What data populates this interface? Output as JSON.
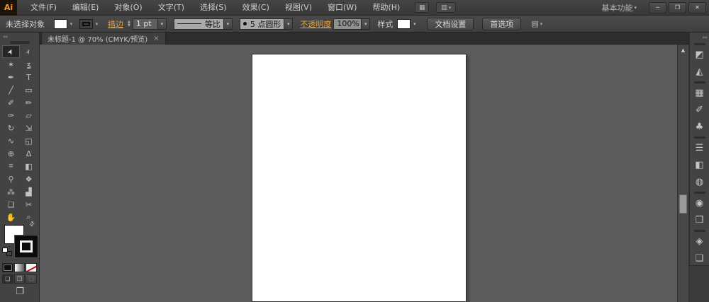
{
  "window": {
    "logo": "Ai",
    "workspace_label": "基本功能",
    "controls": {
      "minimize": "─",
      "restore": "❐",
      "close": "✕"
    }
  },
  "menubar": {
    "items": [
      "文件(F)",
      "编辑(E)",
      "对象(O)",
      "文字(T)",
      "选择(S)",
      "效果(C)",
      "视图(V)",
      "窗口(W)",
      "帮助(H)"
    ]
  },
  "icons": {
    "bridge": "▦",
    "arrange_documents": "▥",
    "dropdown": "▾",
    "collapse_arrows": "««",
    "tab_close": "×",
    "scroll_up": "▲",
    "swap_fill_stroke": "⇄",
    "panel_flyout": "▤",
    "screen_mode": "❐",
    "draw_normal": "❏",
    "draw_behind": "❐",
    "draw_inside": "❑"
  },
  "control_bar": {
    "status": "未选择对象",
    "stroke_link": "描边",
    "stroke_weight": "1 pt",
    "width_profile": "等比",
    "brush": "5 点圆形",
    "opacity_link": "不透明度",
    "opacity_value": "100%",
    "style_label": "样式",
    "document_setup_button": "文档设置",
    "preferences_button": "首选项"
  },
  "tab": {
    "title": "未标题-1 @ 70% (CMYK/预览)"
  },
  "toolbar": {
    "tools": [
      {
        "name": "selection-tool",
        "glyph": "➤",
        "selected": true
      },
      {
        "name": "direct-selection-tool",
        "glyph": "➢"
      },
      {
        "name": "magic-wand-tool",
        "glyph": "✶"
      },
      {
        "name": "lasso-tool",
        "glyph": "ʓ"
      },
      {
        "name": "pen-tool",
        "glyph": "✒"
      },
      {
        "name": "type-tool",
        "glyph": "T"
      },
      {
        "name": "line-segment-tool",
        "glyph": "╱"
      },
      {
        "name": "rectangle-tool",
        "glyph": "▭"
      },
      {
        "name": "paintbrush-tool",
        "glyph": "✐"
      },
      {
        "name": "pencil-tool",
        "glyph": "✏"
      },
      {
        "name": "blob-brush-tool",
        "glyph": "✑"
      },
      {
        "name": "eraser-tool",
        "glyph": "▱"
      },
      {
        "name": "rotate-tool",
        "glyph": "↻"
      },
      {
        "name": "scale-tool",
        "glyph": "⇲"
      },
      {
        "name": "width-tool",
        "glyph": "∿"
      },
      {
        "name": "free-transform-tool",
        "glyph": "◱"
      },
      {
        "name": "shape-builder-tool",
        "glyph": "⊕"
      },
      {
        "name": "perspective-grid-tool",
        "glyph": "∆"
      },
      {
        "name": "mesh-tool",
        "glyph": "⌗"
      },
      {
        "name": "gradient-tool",
        "glyph": "◧"
      },
      {
        "name": "eyedropper-tool",
        "glyph": "⚲"
      },
      {
        "name": "blend-tool",
        "glyph": "❖"
      },
      {
        "name": "symbol-sprayer-tool",
        "glyph": "⁂"
      },
      {
        "name": "column-graph-tool",
        "glyph": "▟"
      },
      {
        "name": "artboard-tool",
        "glyph": "❏"
      },
      {
        "name": "slice-tool",
        "glyph": "✂"
      },
      {
        "name": "hand-tool",
        "glyph": "✋"
      },
      {
        "name": "zoom-tool",
        "glyph": "⌕"
      }
    ]
  },
  "dock": {
    "groups": [
      {
        "icons": [
          {
            "name": "color-panel-icon",
            "glyph": "◩"
          },
          {
            "name": "color-guide-panel-icon",
            "glyph": "◭"
          }
        ]
      },
      {
        "icons": [
          {
            "name": "swatches-panel-icon",
            "glyph": "▦"
          },
          {
            "name": "brushes-panel-icon",
            "glyph": "✐"
          },
          {
            "name": "symbols-panel-icon",
            "glyph": "♣"
          }
        ]
      },
      {
        "icons": [
          {
            "name": "stroke-panel-icon",
            "glyph": "☰"
          },
          {
            "name": "gradient-panel-icon",
            "glyph": "◧"
          },
          {
            "name": "transparency-panel-icon",
            "glyph": "◍"
          }
        ]
      },
      {
        "icons": [
          {
            "name": "appearance-panel-icon",
            "glyph": "◉"
          },
          {
            "name": "graphic-styles-panel-icon",
            "glyph": "❒"
          }
        ]
      },
      {
        "icons": [
          {
            "name": "layers-panel-icon",
            "glyph": "◈"
          },
          {
            "name": "artboards-panel-icon",
            "glyph": "❑"
          }
        ]
      }
    ]
  },
  "colors": {
    "accent_orange": "#e8a33d",
    "canvas_gray": "#5c5c5c",
    "panel_gray": "#434343",
    "artboard_white": "#ffffff"
  }
}
